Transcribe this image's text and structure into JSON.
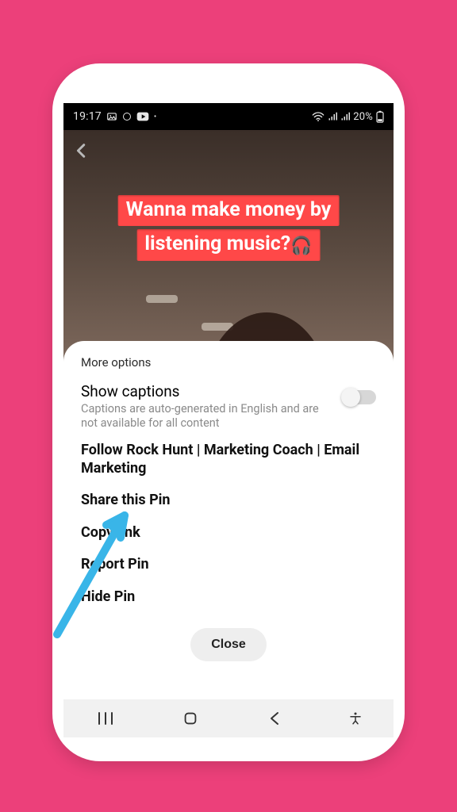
{
  "statusbar": {
    "time": "19:17",
    "battery_text": "20%"
  },
  "content": {
    "overlay_line1": "Wanna make money by",
    "overlay_line2": "listening music?"
  },
  "sheet": {
    "title": "More options",
    "captions": {
      "label": "Show captions",
      "description": "Captions are auto-generated in English and are not available for all content",
      "enabled": false
    },
    "options": {
      "follow": "Follow Rock Hunt | Marketing Coach | Email Marketing",
      "share": "Share this Pin",
      "copy_link": "Copy link",
      "report": "Report Pin",
      "hide": "Hide Pin"
    },
    "close_label": "Close"
  },
  "annotation": {
    "arrow_target": "copy_link",
    "arrow_color": "#39b5e8"
  }
}
